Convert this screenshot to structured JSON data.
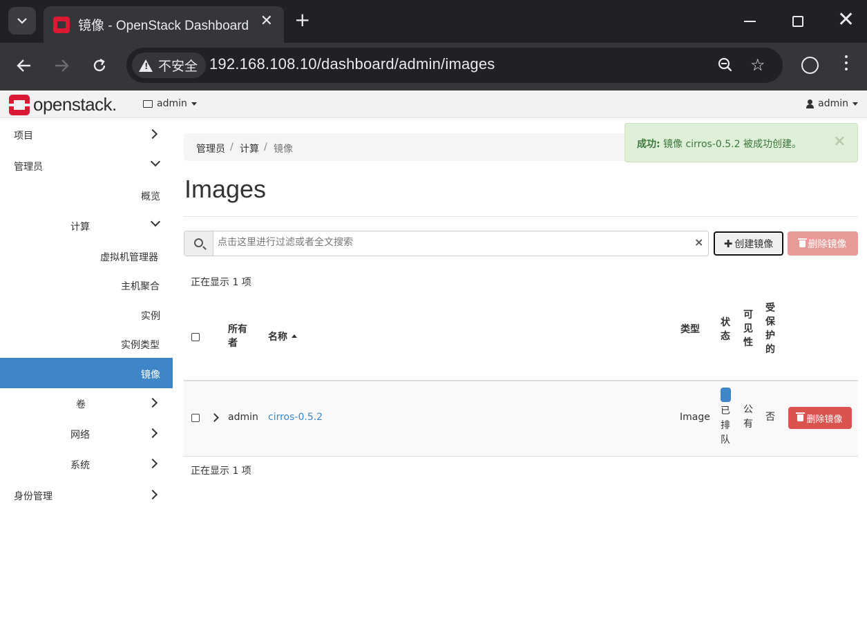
{
  "browser": {
    "tab_title": "镜像 - OpenStack Dashboard",
    "insecure_label": "不安全",
    "url": "192.168.108.10/dashboard/admin/images"
  },
  "navbar": {
    "logo_text": "openstack.",
    "project_label": "admin",
    "user_label": "admin"
  },
  "sidebar": {
    "items": [
      {
        "label": "项目",
        "chevron": "right"
      },
      {
        "label": "管理员",
        "chevron": "down"
      },
      {
        "label": "概览"
      },
      {
        "label": "计算",
        "chevron": "down"
      },
      {
        "label": "虚拟机管理器"
      },
      {
        "label": "主机聚合"
      },
      {
        "label": "实例"
      },
      {
        "label": "实例类型"
      },
      {
        "label": "镜像",
        "active": true
      },
      {
        "label": "卷",
        "chevron": "right"
      },
      {
        "label": "网络",
        "chevron": "right"
      },
      {
        "label": "系统",
        "chevron": "right"
      },
      {
        "label": "身份管理",
        "chevron": "right"
      }
    ]
  },
  "breadcrumb": {
    "items": [
      "管理员",
      "计算",
      "镜像"
    ],
    "separator": "/"
  },
  "alert": {
    "strong": "成功:",
    "message": "镜像 cirros-0.5.2 被成功创建。",
    "close": "×"
  },
  "page": {
    "title": "Images"
  },
  "filter": {
    "placeholder": "点击这里进行过滤或者全文搜索",
    "clear": "×"
  },
  "actions": {
    "create_label": "创建镜像",
    "delete_label": "删除镜像"
  },
  "table": {
    "count_text": "正在显示 1 项",
    "headers": {
      "owner": [
        "所有",
        "者"
      ],
      "name": "名称",
      "type": "类型",
      "status": [
        "状",
        "态"
      ],
      "visibility": [
        "可",
        "见",
        "性"
      ],
      "protected": [
        "受",
        "保",
        "护",
        "的"
      ]
    },
    "rows": [
      {
        "owner": "admin",
        "name": "cirros-0.5.2",
        "type": "Image",
        "status": [
          "已",
          "排",
          "队"
        ],
        "visibility": [
          "公",
          "有"
        ],
        "protected": "否",
        "action_label": "删除镜像"
      }
    ]
  },
  "colors": {
    "accent": "#3f86c8",
    "danger": "#d9534f",
    "brand_red": "#da1a32",
    "success_bg": "#dff0d8"
  }
}
